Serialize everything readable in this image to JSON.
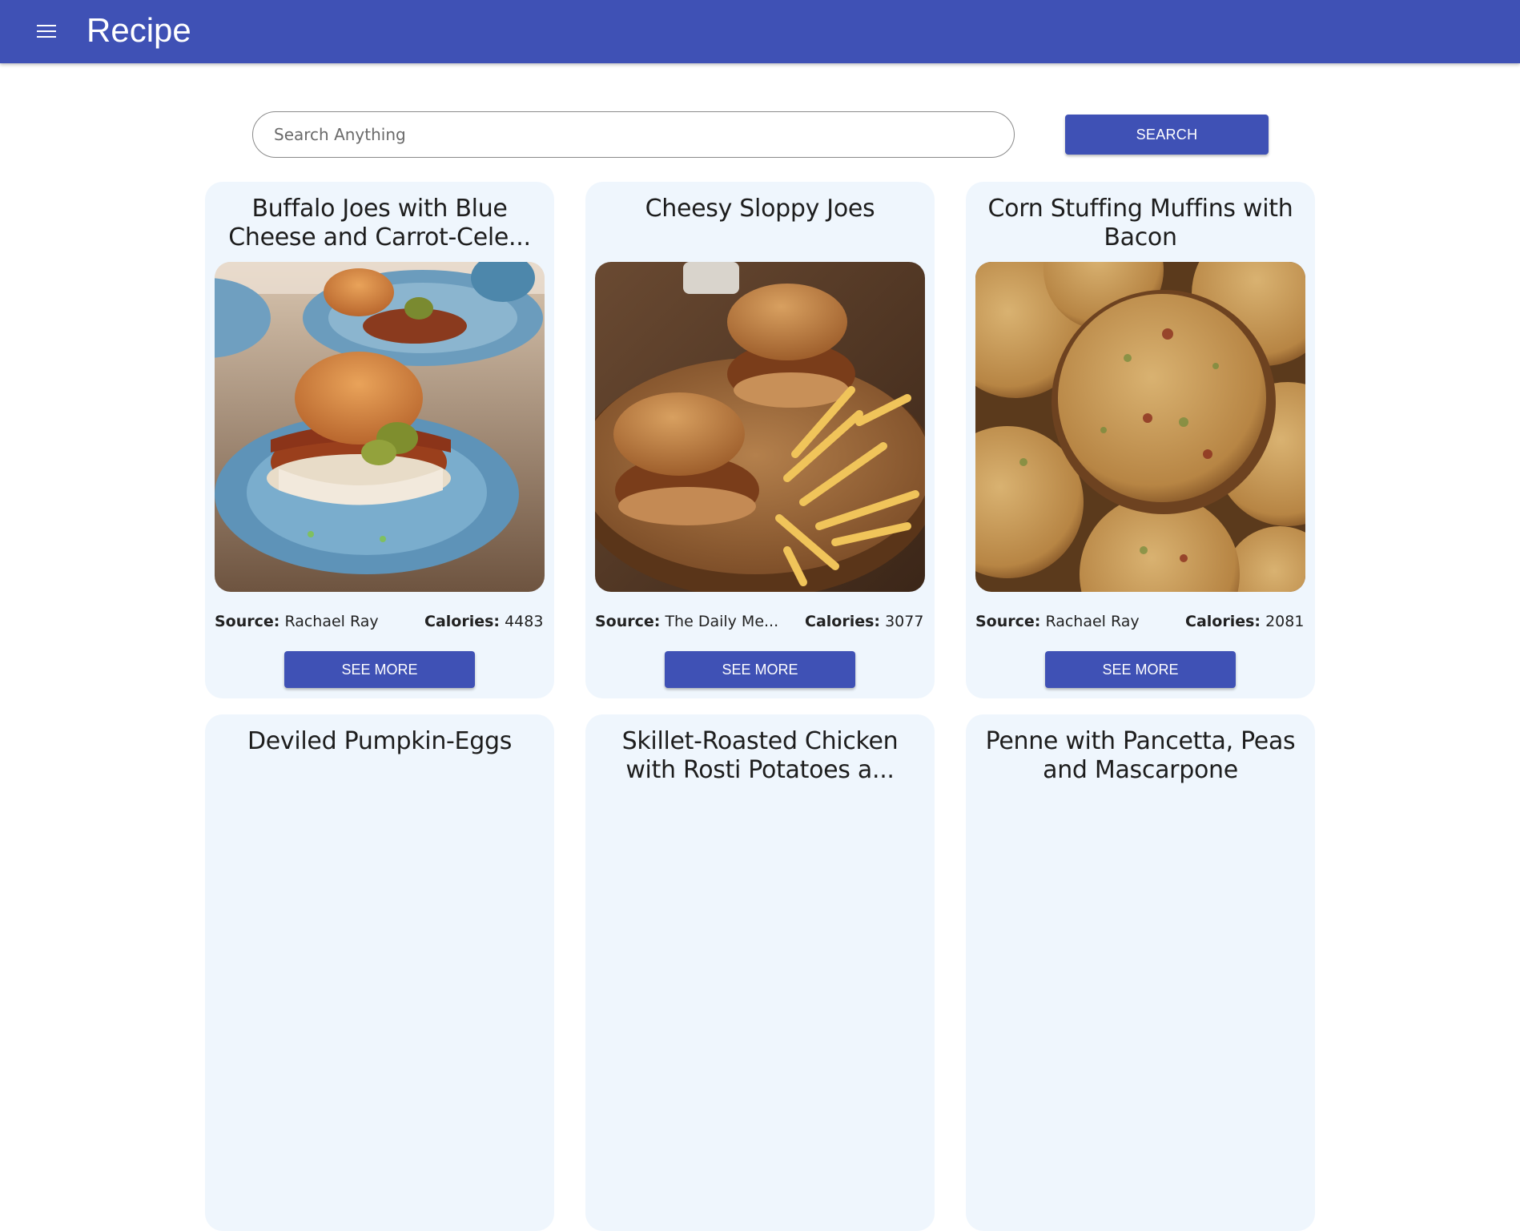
{
  "app": {
    "title": "Recipe",
    "menu_icon": "menu-icon"
  },
  "search": {
    "placeholder": "Search Anything",
    "value": "",
    "button_label": "SEARCH"
  },
  "labels": {
    "source": "Source:",
    "calories": "Calories:",
    "see_more": "SEE MORE"
  },
  "recipes": [
    {
      "title": "Buffalo Joes with Blue Cheese and Carrot-Cele...",
      "source": "Rachael Ray",
      "calories": "4483",
      "image": "sloppy-joe-plate-photo"
    },
    {
      "title": "Cheesy Sloppy Joes",
      "source": "The Daily Me...",
      "calories": "3077",
      "image": "sloppy-joes-fries-photo"
    },
    {
      "title": "Corn Stuffing Muffins with Bacon",
      "source": "Rachael Ray",
      "calories": "2081",
      "image": "muffins-photo"
    },
    {
      "title": "Deviled Pumpkin-Eggs"
    },
    {
      "title": "Skillet-Roasted Chicken with Rosti Potatoes a..."
    },
    {
      "title": "Penne with Pancetta, Peas and Mascarpone"
    }
  ],
  "colors": {
    "primary": "#3f51b5",
    "card_bg": "#eff6fd"
  }
}
